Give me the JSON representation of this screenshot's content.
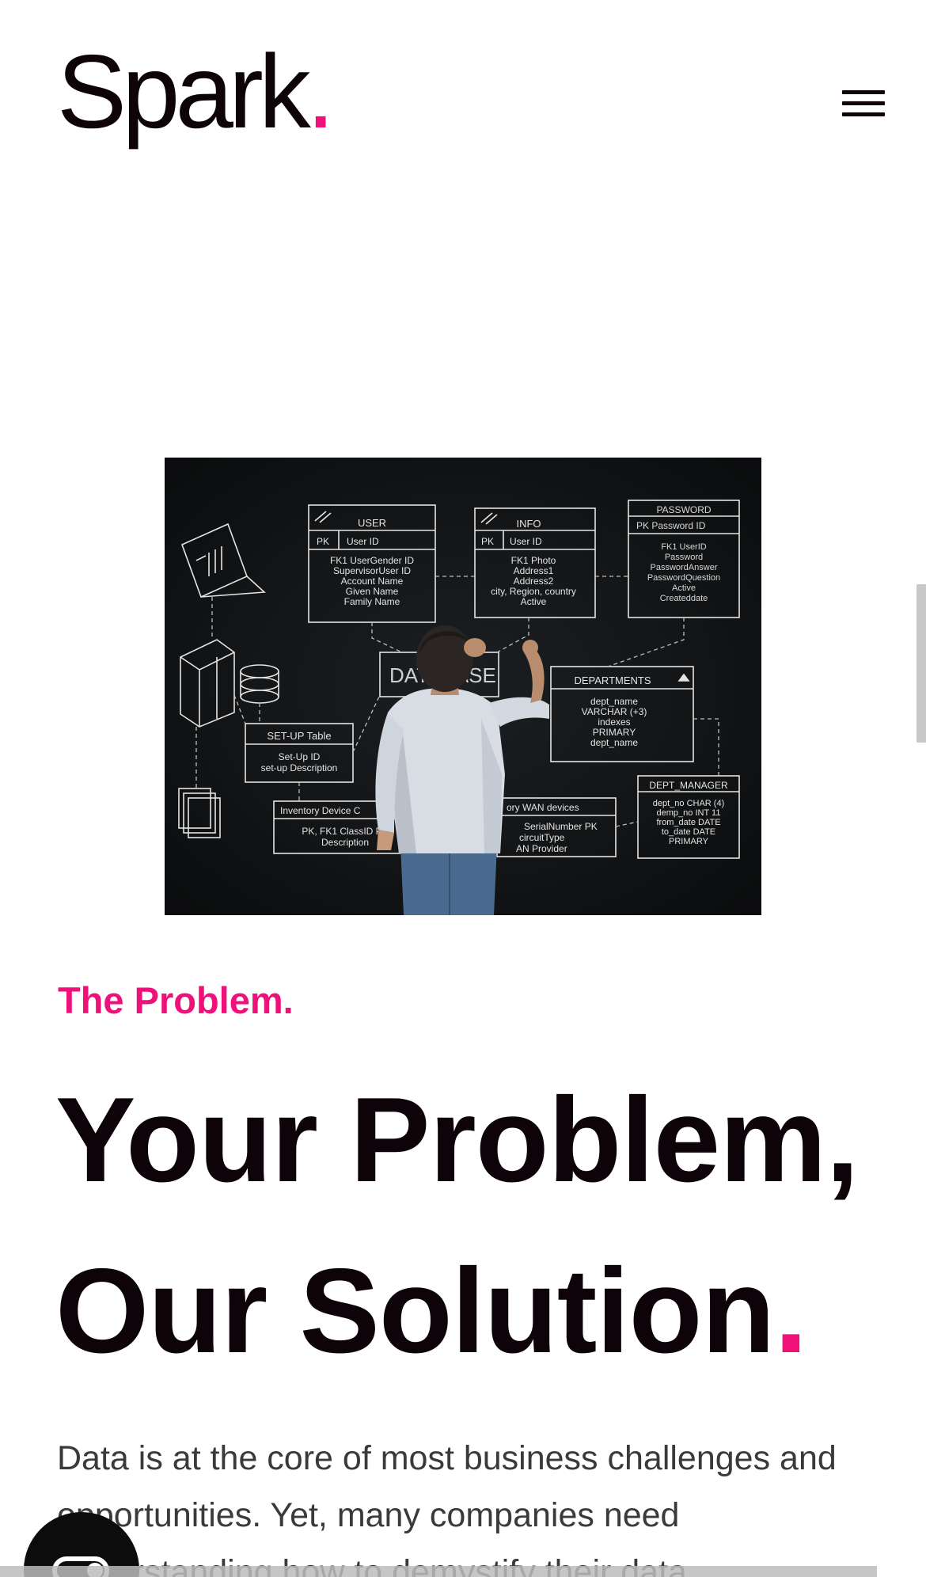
{
  "brand": {
    "logo_text": "Spark",
    "logo_dot": ".",
    "accent_color": "#f0107a",
    "text_color": "#0d0308"
  },
  "header": {
    "menu_icon": "hamburger-menu-icon"
  },
  "hero_image": {
    "chalk_labels": {
      "user_title": "USER",
      "user_pk": "PK",
      "user_id": "User ID",
      "user_fields": [
        "FK1   UserGender ID",
        "SupervisorUser ID",
        "Account Name",
        "Given Name",
        "Family Name"
      ],
      "info_title": "INFO",
      "info_pk": "PK",
      "info_id": "User ID",
      "info_fields": [
        "FK1   Photo",
        "Address1",
        "Address2",
        "city, Region, country",
        "Active"
      ],
      "password_title": "PASSWORD",
      "password_pk": "PK Password ID",
      "password_fields": [
        "FK1     UserID",
        "Password",
        "PasswordAnswer",
        "PasswordQuestion",
        "Active",
        "Createddate"
      ],
      "database_label": "DATABASE",
      "departments_title": "DEPARTMENTS",
      "departments_fields": [
        "dept_name",
        "VARCHAR (+3)",
        "indexes",
        "PRIMARY",
        "dept_name"
      ],
      "setup_title": "SET-UP Table",
      "setup_fields": [
        "Set-Up ID",
        "set-up Description"
      ],
      "inventory_title": "Inventory Device C",
      "inventory_fields": [
        "PK, FK1  ClassID PK",
        "Description"
      ],
      "wan_title": "ory WAN devices",
      "wan_fields": [
        "SerialNumber PK",
        "circuitType",
        "AN Provider"
      ],
      "dept_manager_title": "DEPT_MANAGER",
      "dept_manager_fields": [
        "dept_no CHAR (4)",
        "demp_no INT 11",
        "from_date DATE",
        "to_date DATE",
        "PRIMARY"
      ]
    }
  },
  "section": {
    "eyebrow": "The Problem.",
    "headline_line1": "Your Problem,",
    "headline_line2": "Our Solution",
    "headline_dot": ".",
    "body": "Data is at the core of most business challenges and opportunities. Yet, many companies need understanding how to demystify their data"
  },
  "floating_button": {
    "icon": "toggle-switch-icon"
  }
}
